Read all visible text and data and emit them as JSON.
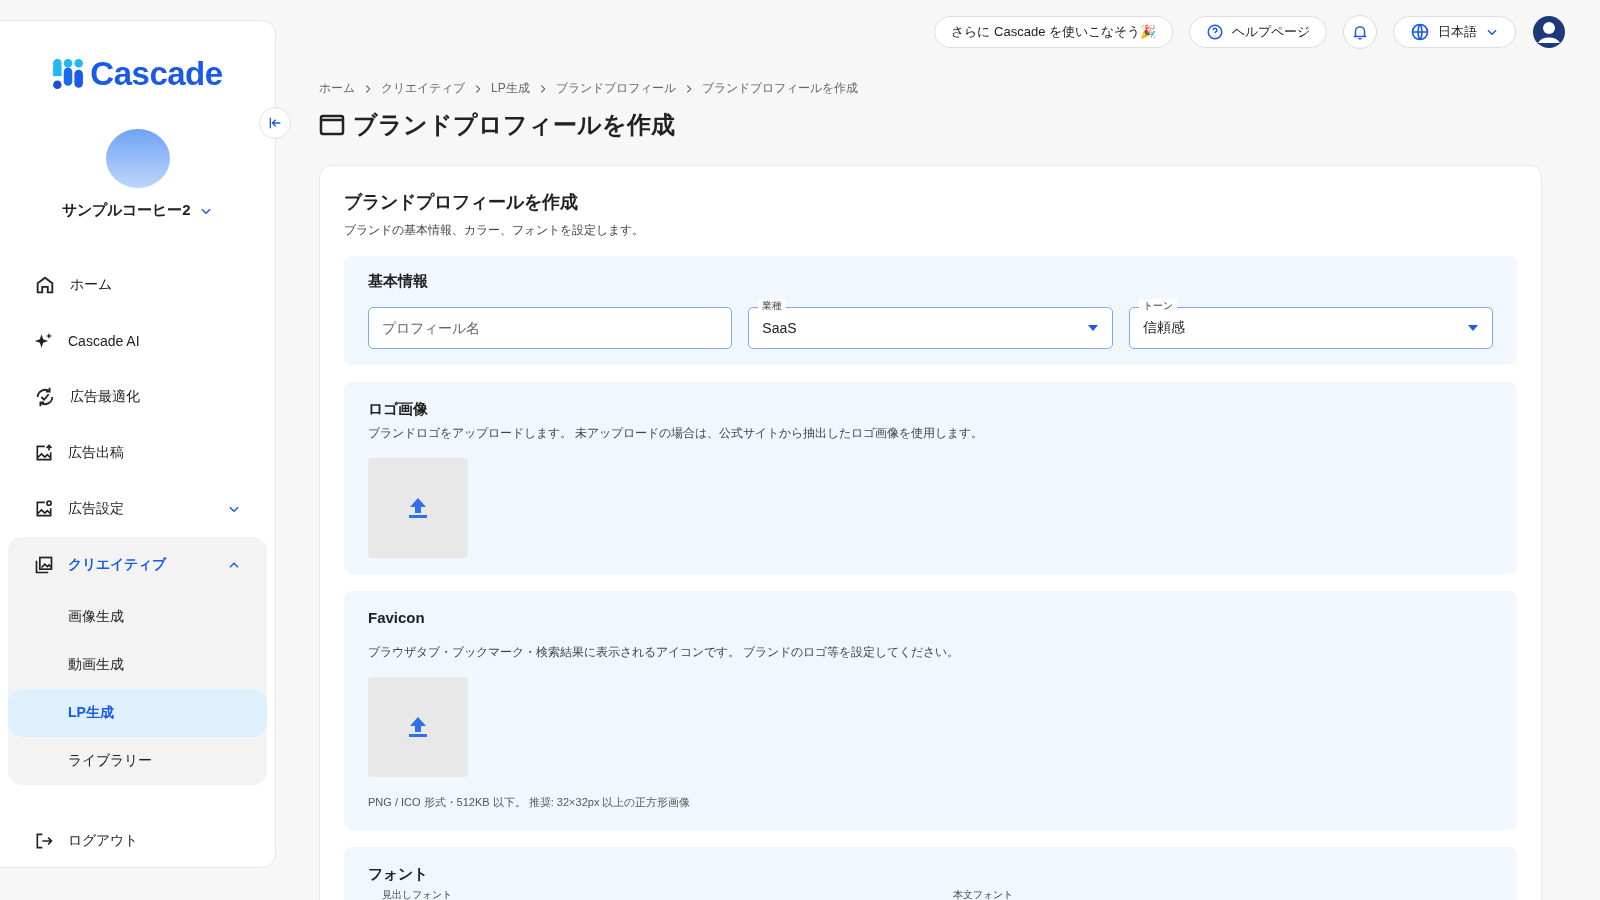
{
  "sidebar": {
    "logo": "Cascade",
    "account": {
      "name": "サンプルコーヒー2"
    },
    "items": [
      {
        "label": "ホーム",
        "selected": false
      },
      {
        "label": "Cascade AI",
        "selected": false
      },
      {
        "label": "広告最適化",
        "selected": false
      },
      {
        "label": "広告出稿",
        "selected": false
      },
      {
        "label": "広告設定",
        "selected": false,
        "expanded": false
      },
      {
        "label": "クリエイティブ",
        "selected": true,
        "expanded": true,
        "children": [
          {
            "label": "画像生成",
            "selected": false
          },
          {
            "label": "動画生成",
            "selected": false
          },
          {
            "label": "LP生成",
            "selected": true
          },
          {
            "label": "ライブラリー",
            "selected": false
          }
        ]
      }
    ],
    "logout": "ログアウト"
  },
  "topbar": {
    "promo": "さらに Cascade を使いこなそう🎉",
    "help": "ヘルプページ",
    "language": "日本語"
  },
  "breadcrumb": [
    "ホーム",
    "クリエイティブ",
    "LP生成",
    "ブランドプロフィール",
    "ブランドプロフィールを作成"
  ],
  "page_title": "ブランドプロフィールを作成",
  "form": {
    "title": "ブランドプロフィールを作成",
    "description": "ブランドの基本情報、カラー、フォントを設定します。",
    "basic": {
      "title": "基本情報",
      "fields": [
        {
          "kind": "text",
          "placeholder": "プロフィール名"
        },
        {
          "kind": "select",
          "label": "業種",
          "value": "SaaS"
        },
        {
          "kind": "select",
          "label": "トーン",
          "value": "信頼感"
        }
      ]
    },
    "logo": {
      "title": "ロゴ画像",
      "description": "ブランドロゴをアップロードします。 未アップロードの場合は、公式サイトから抽出したロゴ画像を使用します。"
    },
    "favicon": {
      "title": "Favicon",
      "description": "ブラウザタブ・ブックマーク・検索結果に表示されるアイコンです。 ブランドのロゴ等を設定してください。",
      "note": "PNG / ICO 形式・512KB 以下。 推奨: 32×32px 以上の正方形画像"
    },
    "fonts": {
      "title": "フォント",
      "fields": [
        {
          "label": "見出しフォント"
        },
        {
          "label": "本文フォント"
        }
      ]
    }
  }
}
